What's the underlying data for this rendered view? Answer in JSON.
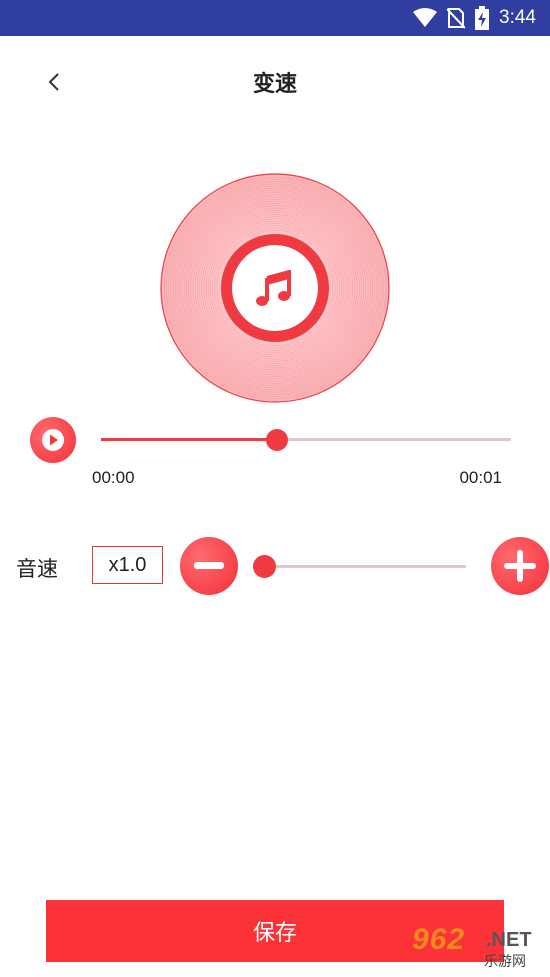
{
  "status_bar": {
    "time": "3:44",
    "icons": [
      "wifi-icon",
      "no-sim-icon",
      "battery-charging-icon"
    ],
    "background": "#303f9f"
  },
  "header": {
    "back_icon": "chevron-left-icon",
    "title": "变速"
  },
  "disc": {
    "icon": "music-note-icon",
    "color": "#ee3a40"
  },
  "player": {
    "play_icon": "play-icon",
    "progress": 0.43,
    "current_time": "00:00",
    "total_time": "00:01"
  },
  "speed": {
    "label": "音速",
    "value": "x1.0",
    "minus_icon": "minus-icon",
    "plus_icon": "plus-icon",
    "slider_level": 0.0
  },
  "save_button": {
    "label": "保存",
    "color": "#fb3339"
  },
  "watermark": {
    "main": "962",
    "net": ".NET",
    "sub": "乐游网"
  },
  "colors": {
    "accent": "#ee3a40",
    "track": "#e0c6cd"
  }
}
